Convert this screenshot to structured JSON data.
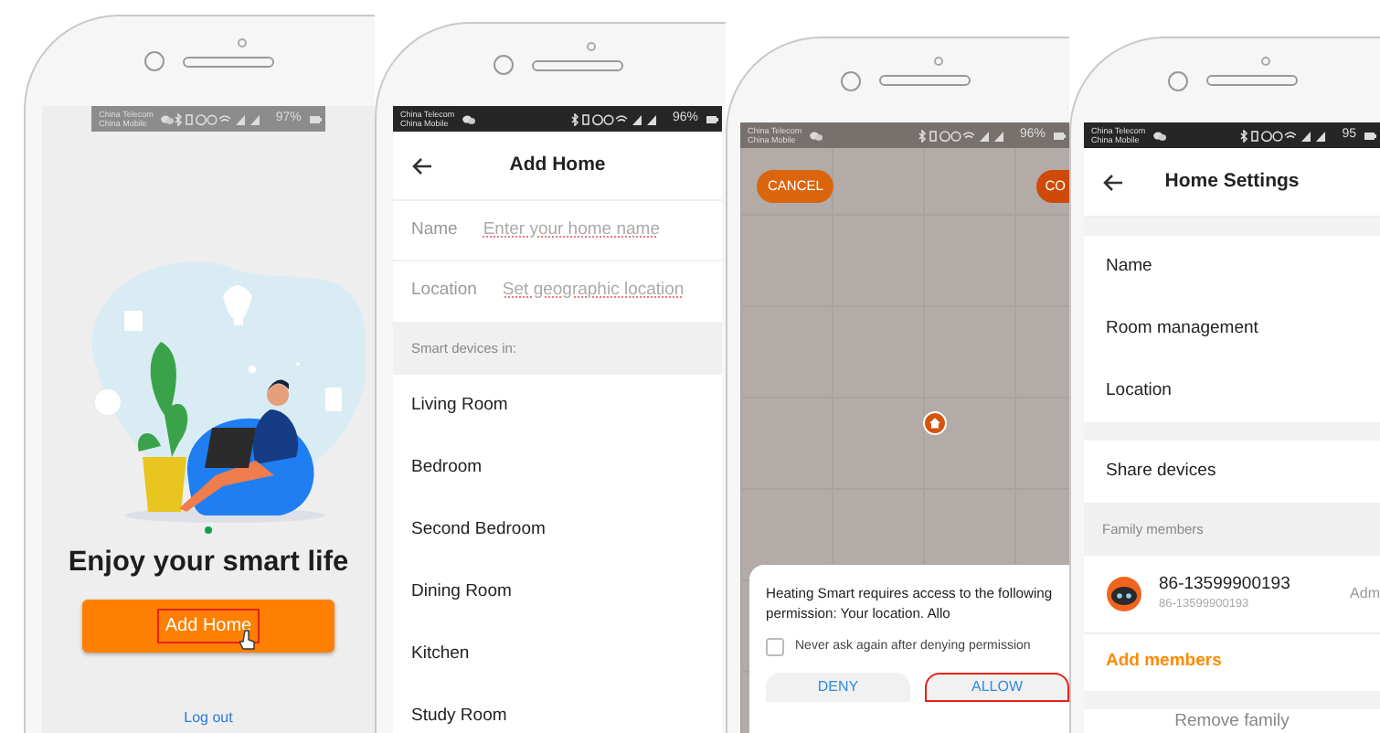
{
  "phones": [
    {
      "kind": "welcome",
      "status_bar": {
        "color": "#8c8c8c",
        "carriers": [
          "China Telecom",
          "China Mobile"
        ],
        "battery": "97%"
      },
      "heading": "Enjoy your smart life",
      "primary_button": {
        "label": "Add Home",
        "highlighted": true
      },
      "link": "Log out"
    },
    {
      "kind": "add_home",
      "status_bar": {
        "color": "#262626",
        "carriers": [
          "China Telecom",
          "China Mobile"
        ],
        "battery": "96%"
      },
      "title": "Add Home",
      "fields": [
        {
          "label": "Name",
          "placeholder": "Enter your home name"
        },
        {
          "label": "Location",
          "placeholder": "Set geographic location"
        }
      ],
      "section": "Smart devices in:",
      "rooms": [
        "Living Room",
        "Bedroom",
        "Second Bedroom",
        "Dining Room",
        "Kitchen",
        "Study Room"
      ]
    },
    {
      "kind": "map_permission",
      "status_bar": {
        "color": "#77706c",
        "carriers": [
          "China Telecom",
          "China Mobile"
        ],
        "battery": "96%"
      },
      "cancel": "CANCEL",
      "confirm": "CO",
      "dialog": {
        "message": "Heating Smart requires access to the following permission: Your location. Allo",
        "checkbox": {
          "label": "Never ask again after denying permission",
          "checked": false
        },
        "buttons": [
          {
            "label": "DENY",
            "highlighted": false
          },
          {
            "label": "ALLOW",
            "highlighted": true
          }
        ]
      }
    },
    {
      "kind": "home_settings",
      "status_bar": {
        "color": "#262626",
        "carriers": [
          "China Telecom",
          "China Mobile"
        ],
        "battery": "95"
      },
      "title": "Home Settings",
      "groups": [
        {
          "items": [
            "Name",
            "Room management",
            "Location"
          ]
        },
        {
          "items": [
            "Share devices"
          ]
        }
      ],
      "section": "Family members",
      "members": [
        {
          "name": "86-13599900193",
          "account": "86-13599900193",
          "role": "Adm"
        }
      ],
      "add_members": "Add members",
      "remove": "Remove family"
    }
  ]
}
